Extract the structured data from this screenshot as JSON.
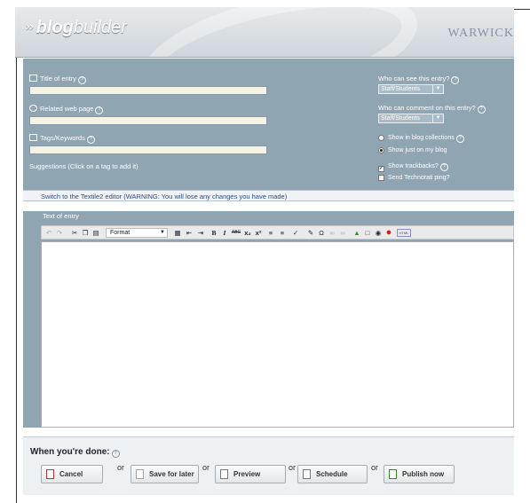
{
  "header": {
    "logo_bold": "blog",
    "logo_rest": "builder",
    "org": "WARWICK"
  },
  "entry": {
    "title_label": "Title of entry",
    "related_label": "Related web page",
    "tags_label": "Tags/Keywords",
    "suggestions_label": "Suggestions (Click on a tag to add it)",
    "title_value": "",
    "related_value": "",
    "tags_value": ""
  },
  "permissions": {
    "view_label": "Who can see this entry?",
    "view_value": "Staff/Students",
    "comment_label": "Who can comment on this entry?",
    "comment_value": "Staff/Students",
    "show_collections": "Show in blog collections",
    "show_just": "Show just on my blog",
    "trackbacks": "Show trackbacks?",
    "technorati": "Send Technorati ping?"
  },
  "switch_text": "Switch to the Textile2 editor (WARNING: You will lose any changes you have made)",
  "editor": {
    "label": "Text of entry",
    "format_label": "Format",
    "content": ""
  },
  "done": {
    "title": "When you're done:",
    "or": "or",
    "cancel": "Cancel",
    "save": "Save for later",
    "preview": "Preview",
    "schedule": "Schedule",
    "publish": "Publish now"
  },
  "colors": {
    "panel": "#90a5b2",
    "input_bg": "#f4f3e6",
    "link": "#2a4a8a"
  }
}
